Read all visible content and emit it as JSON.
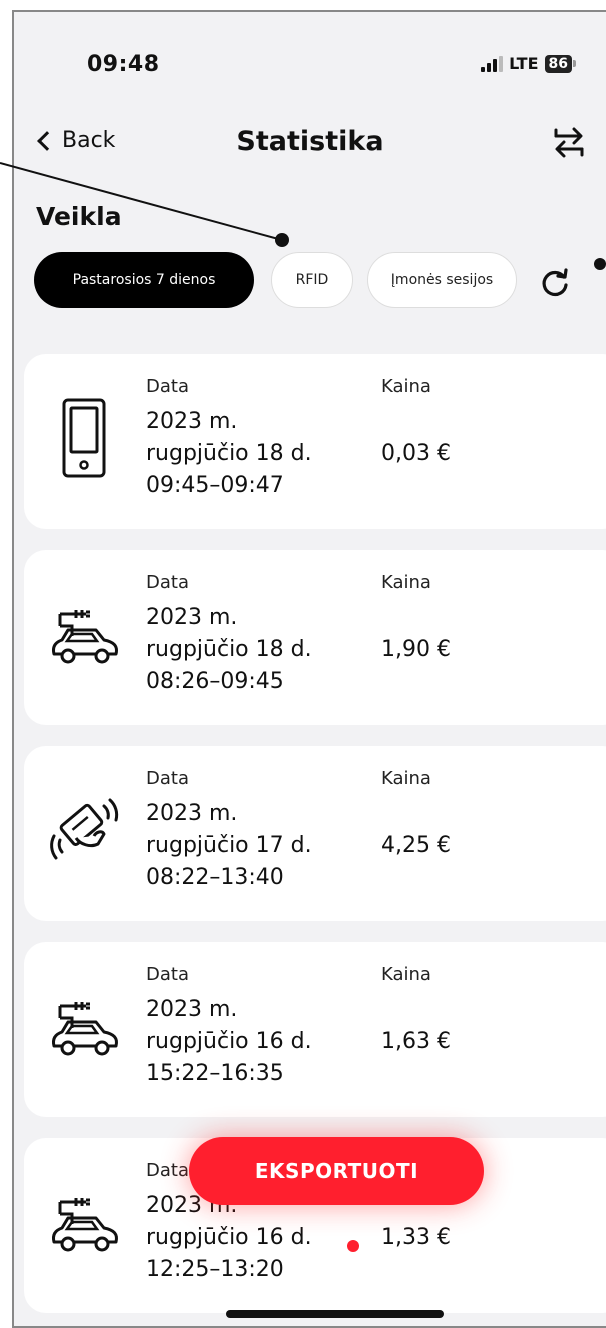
{
  "status": {
    "time": "09:48",
    "network": "LTE",
    "battery": "86"
  },
  "nav": {
    "back_label": "Back",
    "title": "Statistika"
  },
  "section": {
    "title": "Veikla"
  },
  "filters": {
    "active": "Pastarosios 7 dienos",
    "rfid": "RFID",
    "company": "Įmonės sesijos"
  },
  "labels": {
    "date": "Data",
    "price": "Kaina"
  },
  "sessions": [
    {
      "icon": "smartphone-icon",
      "year": "2023 m.",
      "day": "rugpjūčio 18 d.",
      "time": "09:45–09:47",
      "price": "0,03 €"
    },
    {
      "icon": "car-charger-icon",
      "year": "2023 m.",
      "day": "rugpjūčio 18 d.",
      "time": "08:26–09:45",
      "price": "1,90 €"
    },
    {
      "icon": "rfid-card-icon",
      "year": "2023 m.",
      "day": "rugpjūčio 17 d.",
      "time": "08:22–13:40",
      "price": "4,25 €"
    },
    {
      "icon": "car-charger-icon",
      "year": "2023 m.",
      "day": "rugpjūčio 16 d.",
      "time": "15:22–16:35",
      "price": "1,63 €"
    },
    {
      "icon": "car-charger-icon",
      "year": "2023 m.",
      "day": "rugpjūčio 16 d.",
      "time": "12:25–13:20",
      "price": "1,33 €"
    }
  ],
  "export": {
    "label": "EKSPORTUOTI"
  },
  "colors": {
    "accent": "#ff1f2e",
    "background": "#f2f2f4",
    "chip_active": "#000000"
  }
}
